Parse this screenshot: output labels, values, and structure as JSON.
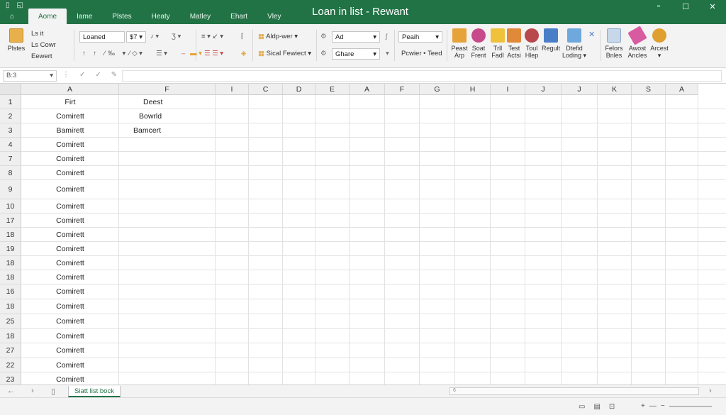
{
  "titlebar": {
    "title": "Loan in list - Rewant",
    "tabs": [
      "Aome",
      "Iame",
      "Plstes",
      "Heaty",
      "Matley",
      "Ehart",
      "Vley"
    ],
    "active_tab": 0,
    "window_controls": [
      "minimize-icon",
      "maximize-icon",
      "close-icon"
    ]
  },
  "ribbon": {
    "paste_label": "Plstes",
    "clipboard": [
      "Ls it",
      "Ls Cowr",
      "Eewert"
    ],
    "font_name": "Loaned",
    "font_size": "$7",
    "align_dropdown": "Aldp-wer",
    "style_dropdown": "Sical Fewiect",
    "number_format": "Ad",
    "share_dropdown": "Ghare",
    "paste_format": "Peaih",
    "power_label": "Pcwier • Teed",
    "buttons": [
      {
        "label1": "Peast",
        "label2": "Arp",
        "color": "#e5a33a"
      },
      {
        "label1": "Soat",
        "label2": "Frent",
        "color": "#c74a8a"
      },
      {
        "label1": "Trll",
        "label2": "Fadl",
        "color": "#f0c23b"
      },
      {
        "label1": "Test",
        "label2": "Actsi",
        "color": "#e0893a"
      },
      {
        "label1": "Toul",
        "label2": "Hlep",
        "color": "#b8484b"
      },
      {
        "label1": "Regult",
        "label2": "",
        "color": "#4a7fc7"
      },
      {
        "label1": "Dtefid",
        "label2": "Loding",
        "color": "#6fa8dc"
      },
      {
        "label1": "Felors",
        "label2": "Bnles",
        "color": "#5b9bd5"
      },
      {
        "label1": "Awost",
        "label2": "Ancles",
        "color": "#d85aa0"
      },
      {
        "label1": "Arcest",
        "label2": "",
        "color": "#e0a030"
      }
    ]
  },
  "formula_bar": {
    "name_box": "B:3",
    "formula": ""
  },
  "grid": {
    "columns": [
      "A",
      "F",
      "I",
      "C",
      "D",
      "E",
      "A",
      "F",
      "G",
      "H",
      "I",
      "J",
      "J",
      "K",
      "S",
      "A"
    ],
    "rows": [
      {
        "num": "1",
        "a": "Firt",
        "b": "Deest"
      },
      {
        "num": "2",
        "a": "Comirett",
        "b": "Bowrld"
      },
      {
        "num": "3",
        "a": "Bamirett",
        "b": "Bamcert"
      },
      {
        "num": "4",
        "a": "Comirett",
        "b": ""
      },
      {
        "num": "7",
        "a": "Comirett",
        "b": ""
      },
      {
        "num": "8",
        "a": "Comirett",
        "b": ""
      },
      {
        "num": "9",
        "a": "Comirett",
        "b": ""
      },
      {
        "num": "10",
        "a": "Comirett",
        "b": ""
      },
      {
        "num": "17",
        "a": "Comirett",
        "b": ""
      },
      {
        "num": "18",
        "a": "Comirett",
        "b": ""
      },
      {
        "num": "19",
        "a": "Comirett",
        "b": ""
      },
      {
        "num": "18",
        "a": "Comirett",
        "b": ""
      },
      {
        "num": "18",
        "a": "Comirett",
        "b": ""
      },
      {
        "num": "16",
        "a": "Comirett",
        "b": ""
      },
      {
        "num": "18",
        "a": "Comirett",
        "b": ""
      },
      {
        "num": "25",
        "a": "Comirett",
        "b": ""
      },
      {
        "num": "18",
        "a": "Comirett",
        "b": ""
      },
      {
        "num": "27",
        "a": "Comirett",
        "b": ""
      },
      {
        "num": "22",
        "a": "Comirett",
        "b": ""
      },
      {
        "num": "23",
        "a": "Comirett",
        "b": ""
      }
    ]
  },
  "sheets": {
    "active": "Siatt list bock",
    "scroll_label": "6"
  },
  "colors": {
    "accent": "#217346"
  }
}
